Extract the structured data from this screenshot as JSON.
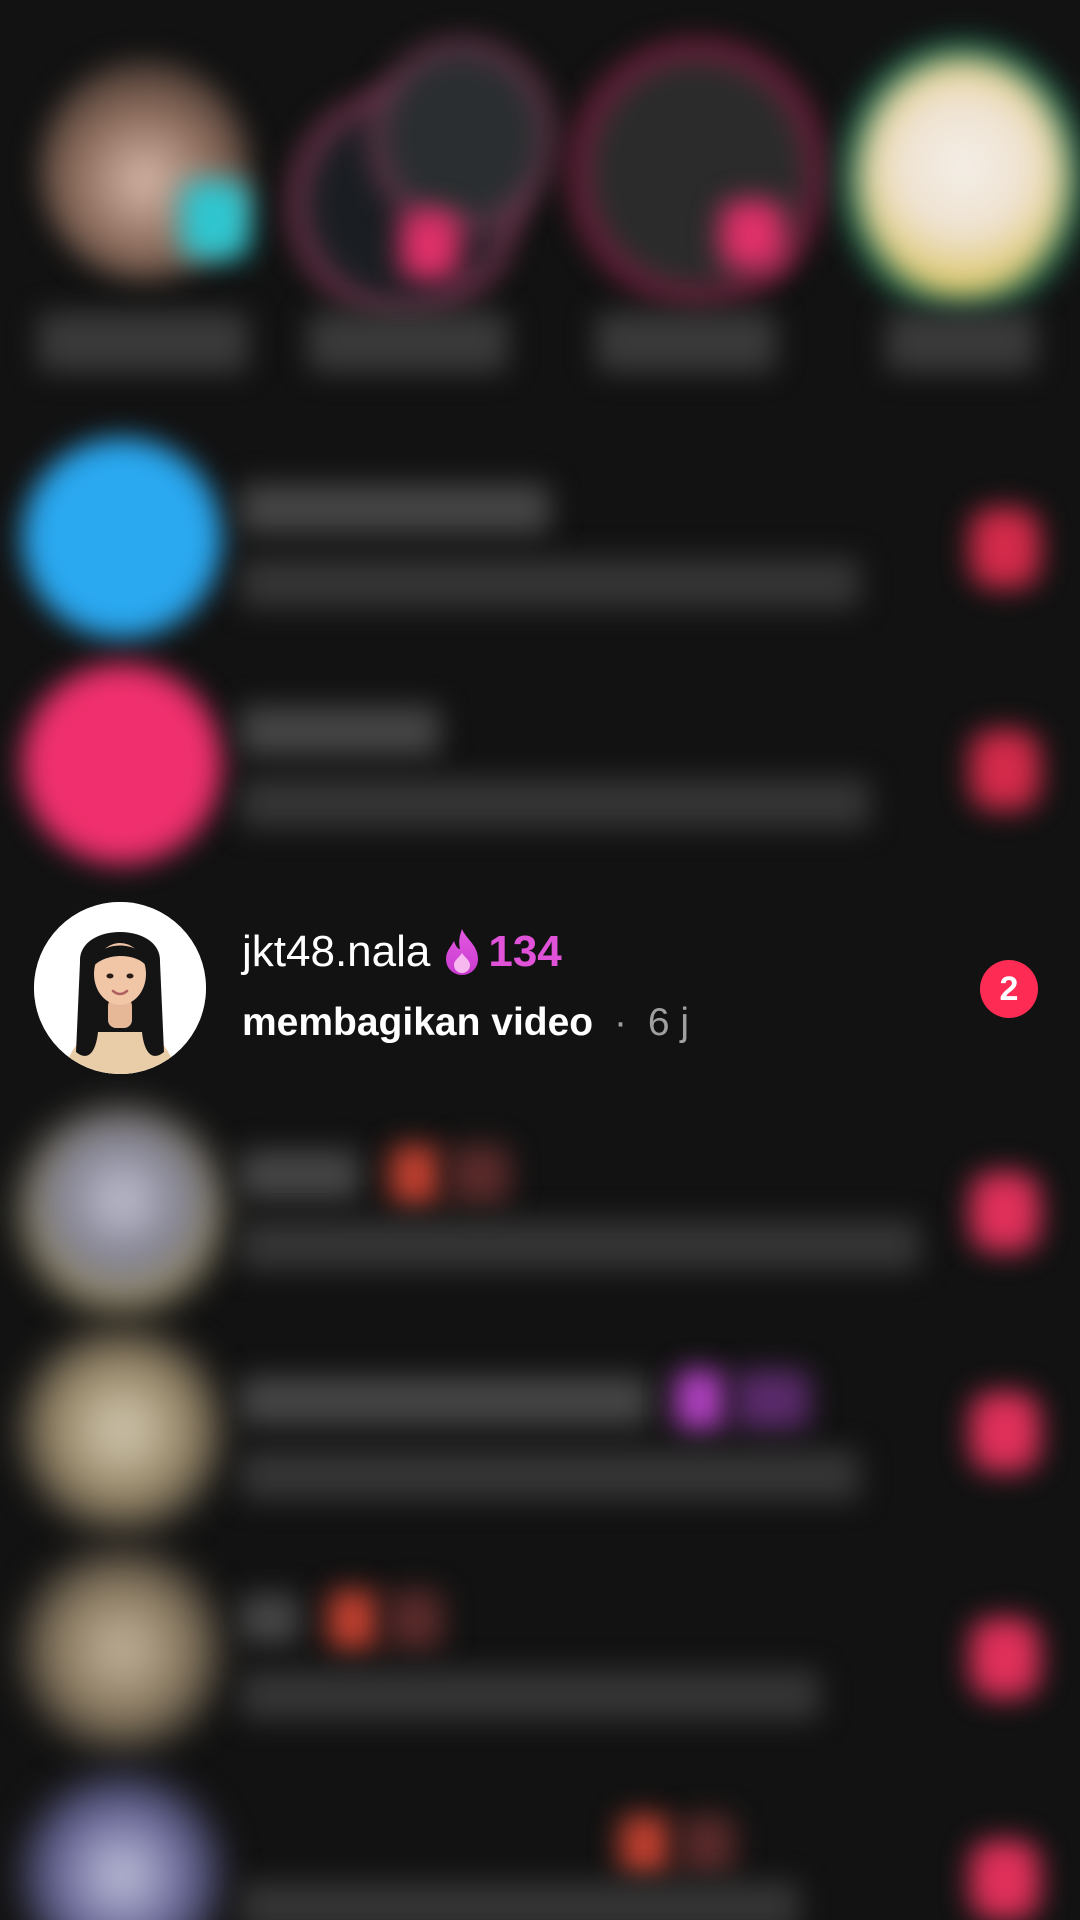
{
  "focused_conversation": {
    "username": "jkt48.nala",
    "streak_icon": "fire-icon",
    "streak_count": "134",
    "action_text": "membagikan video",
    "separator": "·",
    "time_ago": "6 j",
    "unread_count": "2",
    "colors": {
      "streak": "#e052d8",
      "badge": "#fe2c55",
      "background": "#121212"
    }
  }
}
